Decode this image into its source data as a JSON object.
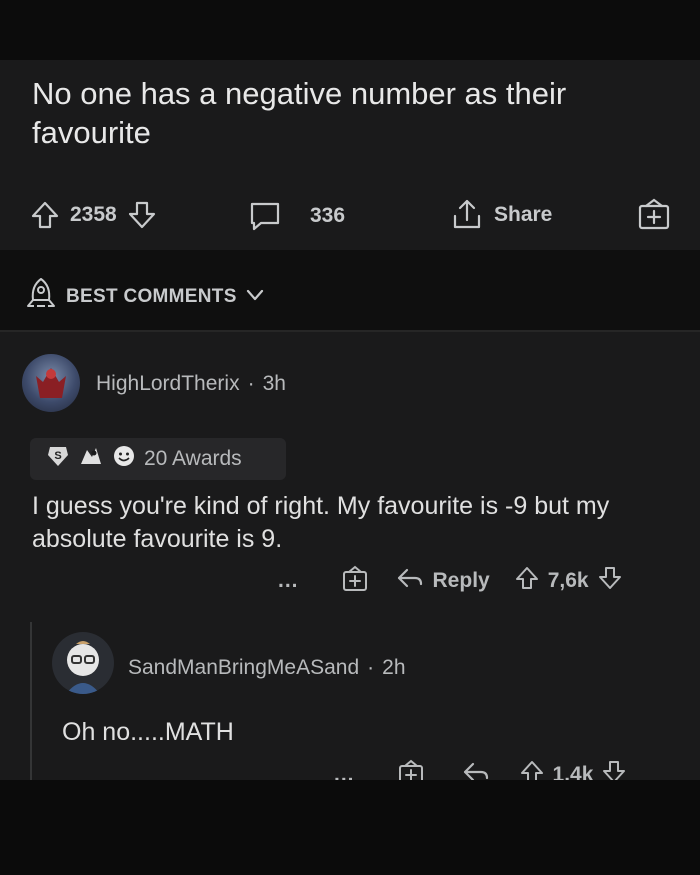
{
  "post": {
    "title": "No one has a negative number as their favourite",
    "score": "2358",
    "comment_count": "336",
    "share_label": "Share"
  },
  "sort": {
    "label": "BEST COMMENTS"
  },
  "comments": [
    {
      "username": "HighLordTherix",
      "separator": "·",
      "age": "3h",
      "awards_label": "20 Awards",
      "body": "I guess you're kind of right. My favourite is -9 but my absolute favourite is 9.",
      "more": "...",
      "reply_label": "Reply",
      "score": "7,6k"
    },
    {
      "username": "SandManBringMeASand",
      "separator": "·",
      "age": "2h",
      "body": "Oh no.....MATH",
      "more": "...",
      "score": "1.4k"
    }
  ],
  "colors": {
    "background": "#101010",
    "card": "#1a1a1b",
    "text": "#d7dadc",
    "muted": "#b8babc"
  },
  "icons": [
    "upvote-icon",
    "downvote-icon",
    "comment-icon",
    "share-icon",
    "award-icon",
    "rocket-icon",
    "chevron-down-icon",
    "reply-icon",
    "more-icon"
  ]
}
